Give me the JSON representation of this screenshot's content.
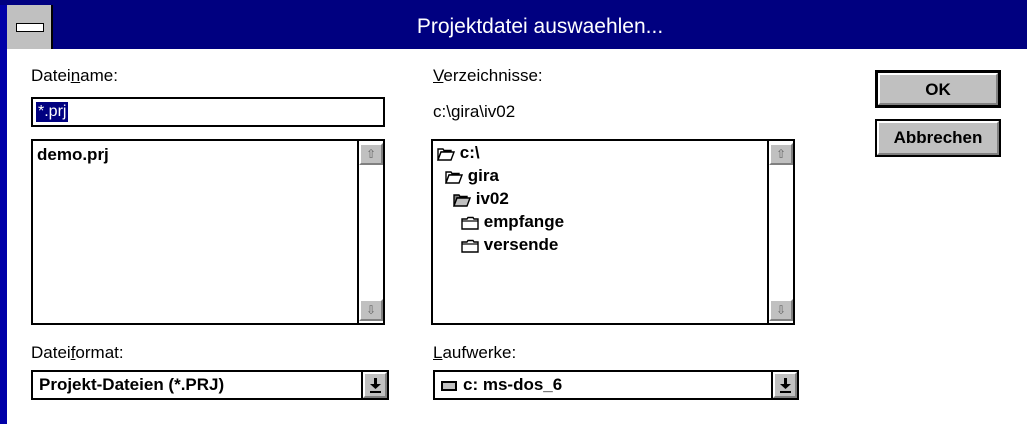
{
  "window": {
    "title": "Projektdatei auswaehlen..."
  },
  "filename": {
    "label_pre": "Datei",
    "label_accel": "n",
    "label_post": "ame:",
    "value": "*.prj",
    "files": [
      "demo.prj"
    ]
  },
  "directories": {
    "label_accel": "V",
    "label_post": "erzeichnisse:",
    "current_path": "c:\\gira\\iv02",
    "items": [
      {
        "name": "c:\\",
        "icon": "open-folder-icon"
      },
      {
        "name": "gira",
        "icon": "open-folder-icon"
      },
      {
        "name": "iv02",
        "icon": "open-folder-selected-icon"
      },
      {
        "name": "empfange",
        "icon": "folder-icon"
      },
      {
        "name": "versende",
        "icon": "folder-icon"
      }
    ]
  },
  "file_format": {
    "label_pre": "Datei",
    "label_accel": "f",
    "label_post": "ormat:",
    "selected": "Projekt-Dateien (*.PRJ)"
  },
  "drives": {
    "label_accel": "L",
    "label_post": "aufwerke:",
    "selected": "c: ms-dos_6",
    "icon": "drive-icon"
  },
  "buttons": {
    "ok": "OK",
    "cancel": "Abbrechen"
  },
  "scroll_glyphs": {
    "up": "⇧",
    "down": "⇩",
    "combo": "⭳"
  },
  "colors": {
    "titlebar": "#000080",
    "selection": "#000080",
    "button_face": "#c0c0c0"
  }
}
